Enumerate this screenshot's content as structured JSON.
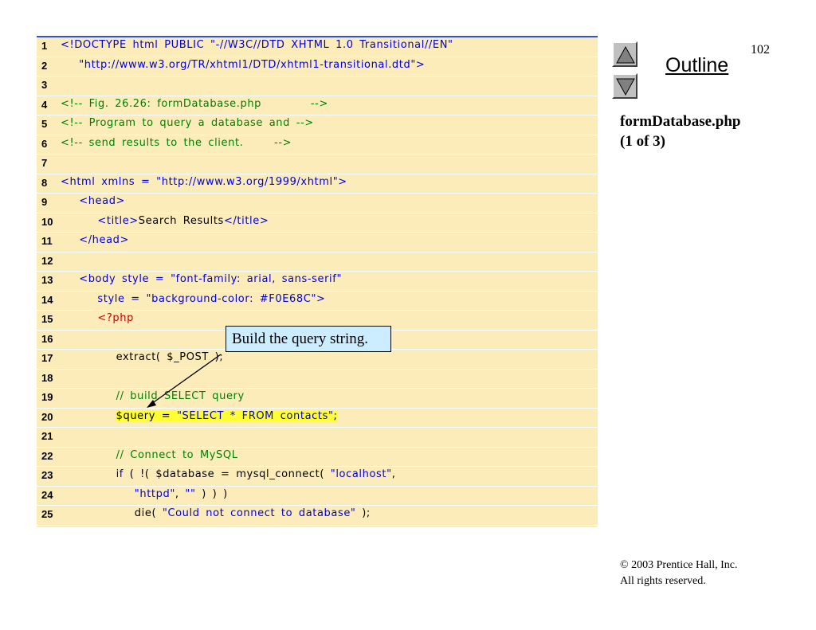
{
  "slide": {
    "page_number": "102",
    "outline_label": "Outline",
    "file_title": "formDatabase.php",
    "file_part": "(1 of 3)",
    "callout": "Build the query string.",
    "copyright_line1": "© 2003 Prentice Hall, Inc.",
    "copyright_line2": "All rights reserved."
  },
  "nav": {
    "up_icon": "triangle-up-icon",
    "down_icon": "triangle-down-icon"
  },
  "colors": {
    "code_bg": "#fbecba",
    "highlight": "#ffff33",
    "callout_bg": "#ccecff"
  },
  "lines": [
    {
      "n": "1",
      "segs": [
        {
          "t": "<!DOCTYPE html PUBLIC \"-//W3C//DTD XHTML 1.0 Transitional//EN\"",
          "c": "blue"
        }
      ]
    },
    {
      "n": "2",
      "segs": [
        {
          "t": "   \"http://www.w3.org/TR/xhtml1/DTD/xhtml1-transitional.dtd\">",
          "c": "blue"
        }
      ]
    },
    {
      "n": "3",
      "segs": []
    },
    {
      "n": "4",
      "segs": [
        {
          "t": "<!-- Fig. 26.26: formDatabase.php        -->",
          "c": "green"
        }
      ]
    },
    {
      "n": "5",
      "segs": [
        {
          "t": "<!-- Program to query a database and -->",
          "c": "green"
        }
      ]
    },
    {
      "n": "6",
      "segs": [
        {
          "t": "<!-- send results to the client.     -->",
          "c": "green"
        }
      ]
    },
    {
      "n": "7",
      "segs": []
    },
    {
      "n": "8",
      "segs": [
        {
          "t": "<html xmlns = \"http://www.w3.org/1999/xhtml\">",
          "c": "blue"
        }
      ]
    },
    {
      "n": "9",
      "segs": [
        {
          "t": "   <head>",
          "c": "blue"
        }
      ]
    },
    {
      "n": "10",
      "segs": [
        {
          "t": "      <title>",
          "c": "blue"
        },
        {
          "t": "Search Results",
          "c": "black"
        },
        {
          "t": "</title>",
          "c": "blue"
        }
      ]
    },
    {
      "n": "11",
      "segs": [
        {
          "t": "   </head>",
          "c": "blue"
        }
      ]
    },
    {
      "n": "12",
      "segs": []
    },
    {
      "n": "13",
      "segs": [
        {
          "t": "   <body style = \"font-family: arial, sans-serif\"",
          "c": "blue"
        }
      ]
    },
    {
      "n": "14",
      "segs": [
        {
          "t": "      style = \"background-color: #F0E68C\">",
          "c": "blue"
        }
      ]
    },
    {
      "n": "15",
      "segs": [
        {
          "t": "      <?php",
          "c": "red"
        }
      ]
    },
    {
      "n": "16",
      "segs": []
    },
    {
      "n": "17",
      "segs": [
        {
          "t": "         extract( $_POST );",
          "c": "black"
        }
      ]
    },
    {
      "n": "18",
      "segs": []
    },
    {
      "n": "19",
      "segs": [
        {
          "t": "         // build SELECT query",
          "c": "green"
        }
      ]
    },
    {
      "n": "20",
      "segs": [
        {
          "t": "         ",
          "c": "black"
        },
        {
          "t": "$query = ",
          "c": "black",
          "hl": true
        },
        {
          "t": "\"SELECT * FROM contacts\"",
          "c": "blue",
          "hl": true
        },
        {
          "t": ";",
          "c": "black",
          "hl": true
        }
      ]
    },
    {
      "n": "21",
      "segs": []
    },
    {
      "n": "22",
      "segs": [
        {
          "t": "         // Connect to MySQL",
          "c": "green"
        }
      ]
    },
    {
      "n": "23",
      "segs": [
        {
          "t": "         ",
          "c": "black"
        },
        {
          "t": "if",
          "c": "blue"
        },
        {
          "t": " ( !( $database = mysql_connect( ",
          "c": "black"
        },
        {
          "t": "\"localhost\"",
          "c": "blue"
        },
        {
          "t": ",",
          "c": "black"
        }
      ]
    },
    {
      "n": "24",
      "segs": [
        {
          "t": "            ",
          "c": "black"
        },
        {
          "t": "\"httpd\"",
          "c": "blue"
        },
        {
          "t": ", ",
          "c": "black"
        },
        {
          "t": "\"\"",
          "c": "blue"
        },
        {
          "t": " ) ) )",
          "c": "black"
        }
      ]
    },
    {
      "n": "25",
      "segs": [
        {
          "t": "            die( ",
          "c": "black"
        },
        {
          "t": "\"Could not connect to database\"",
          "c": "blue"
        },
        {
          "t": " );",
          "c": "black"
        }
      ]
    }
  ]
}
